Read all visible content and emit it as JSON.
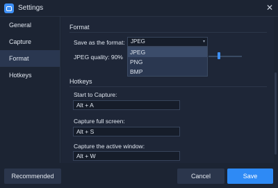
{
  "window": {
    "title": "Settings"
  },
  "sidebar": {
    "items": [
      {
        "label": "General"
      },
      {
        "label": "Capture"
      },
      {
        "label": "Format",
        "active": true
      },
      {
        "label": "Hotkeys"
      }
    ]
  },
  "format": {
    "heading": "Format",
    "save_label": "Save as the format:",
    "selected": "JPEG",
    "options": [
      "JPEG",
      "PNG",
      "BMP"
    ],
    "quality_label": "JPEG quality: 90%",
    "quality_value": 90
  },
  "hotkeys": {
    "heading": "Hotkeys",
    "items": [
      {
        "label": "Start to Capture:",
        "value": "Alt + A"
      },
      {
        "label": "Capture full screen:",
        "value": "Alt + S"
      },
      {
        "label": "Capture the active window:",
        "value": "Alt + W"
      }
    ]
  },
  "footer": {
    "recommended_label": "Recommended",
    "cancel_label": "Cancel",
    "save_label": "Save"
  },
  "colors": {
    "accent": "#2e8af5",
    "background": "#1c2433",
    "panel": "#1e2637"
  }
}
